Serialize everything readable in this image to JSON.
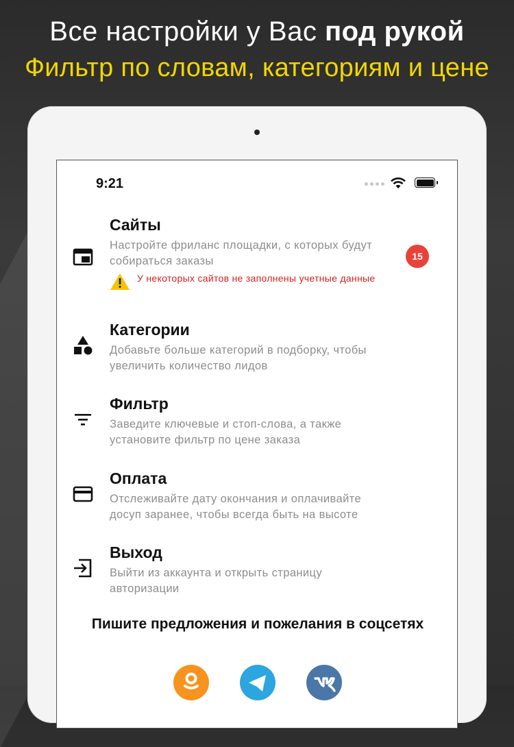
{
  "promo": {
    "line1_normal": "Все настройки у Вас ",
    "line1_bold": "под рукой",
    "line2": "Фильтр по словам, категориям и цене"
  },
  "status_bar": {
    "time": "9:21"
  },
  "menu": [
    {
      "title": "Сайты",
      "desc": "Настройте фриланс площадки, с которых будут собираться заказы",
      "icon": "browser-window-icon",
      "badge": "15",
      "warning": "У некоторых сайтов не заполнены учетные данные"
    },
    {
      "title": "Категории",
      "desc": "Добавьте больше категорий в подборку, чтобы увеличить количество лидов",
      "icon": "shapes-icon"
    },
    {
      "title": "Фильтр",
      "desc": "Заведите ключевые и стоп-слова, а также установите фильтр по цене заказа",
      "icon": "filter-icon"
    },
    {
      "title": "Оплата",
      "desc": "Отслеживайте дату окончания и оплачивайте досуп заранее, чтобы всегда быть на высоте",
      "icon": "credit-card-icon"
    },
    {
      "title": "Выход",
      "desc": "Выйти из аккаунта и открыть страницу авторизации",
      "icon": "logout-icon"
    }
  ],
  "feedback": {
    "text": "Пишите предложения и пожелания в соцсетях"
  },
  "social": [
    {
      "name": "odnoklassniki",
      "color": "#f7931e",
      "icon": "odnoklassniki-icon"
    },
    {
      "name": "telegram",
      "color": "#2ca5e0",
      "icon": "telegram-icon"
    },
    {
      "name": "vk",
      "color": "#4a76a8",
      "icon": "vk-icon"
    }
  ],
  "colors": {
    "accent_yellow": "#f2d600",
    "badge_red": "#e8433a",
    "warning_red": "#d32020",
    "warning_yellow": "#f5c400"
  }
}
